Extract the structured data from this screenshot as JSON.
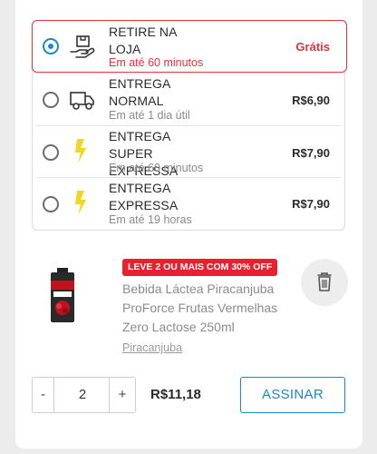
{
  "delivery_options": [
    {
      "title": "RETIRE NA LOJA",
      "subtitle": "Em até 60 minutos",
      "price": "Grátis",
      "icon": "store-pickup-icon",
      "selected": true
    },
    {
      "title": "ENTREGA NORMAL",
      "subtitle": "Em até 1 dia útil",
      "price": "R$6,90",
      "icon": "truck-icon",
      "selected": false
    },
    {
      "title": "ENTREGA SUPER EXPRESSA",
      "subtitle": "Em até 60 minutos",
      "price": "R$7,90",
      "icon": "lightning-icon",
      "selected": false
    },
    {
      "title": "ENTREGA EXPRESSA",
      "subtitle": "Em até 19 horas",
      "price": "R$7,90",
      "icon": "lightning-icon",
      "selected": false
    }
  ],
  "product": {
    "promo": "LEVE 2 OU MAIS COM 30% OFF",
    "name": "Bebida Láctea Piracanjuba ProForce Frutas Vermelhas Zero Lactose 250ml",
    "brand": "Piracanjuba"
  },
  "cart": {
    "minus_label": "-",
    "quantity": "2",
    "plus_label": "+",
    "price": "R$11,18",
    "subscribe_label": "ASSINAR"
  },
  "colors": {
    "accent_red": "#e4323b",
    "accent_blue": "#1f86c8",
    "promo_red": "#e8202f"
  }
}
